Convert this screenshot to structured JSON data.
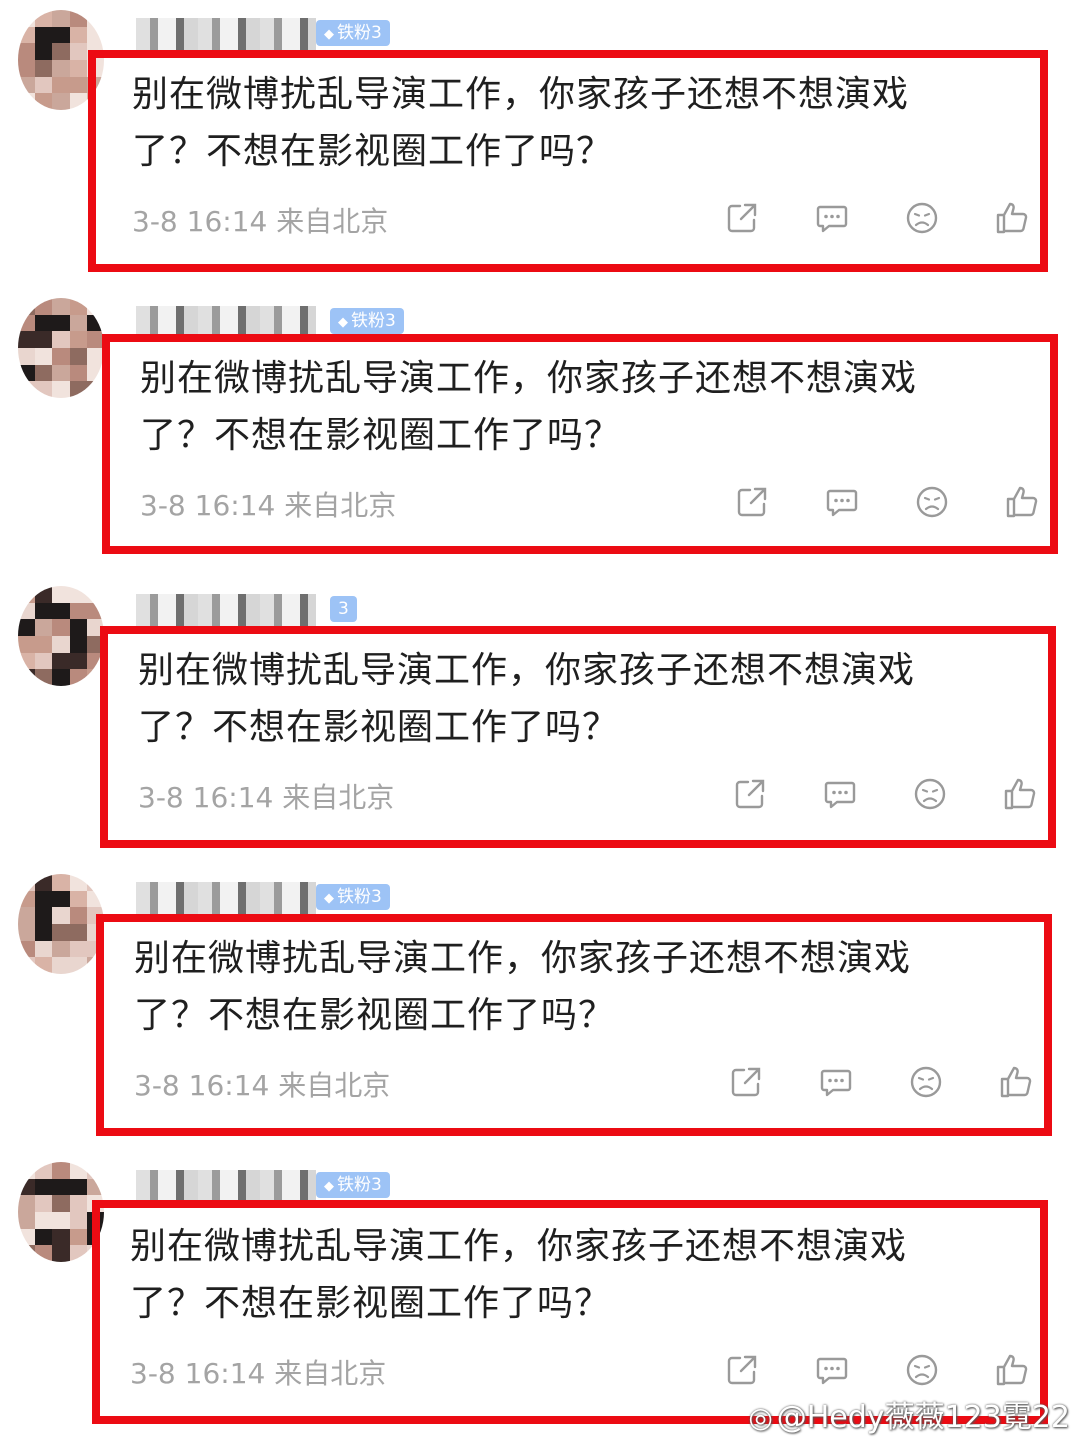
{
  "comments": [
    {
      "badge": "铁粉3",
      "text_line1": "别在微博扰乱导演工作，你家孩子还想不想演戏",
      "text_line2": "了？不想在影视圈工作了吗？",
      "meta": "3-8 16:14  来自北京"
    },
    {
      "badge": "铁粉3",
      "text_line1": "别在微博扰乱导演工作，你家孩子还想不想演戏",
      "text_line2": "了？不想在影视圈工作了吗？",
      "meta": "3-8 16:14  来自北京"
    },
    {
      "badge": "3",
      "text_line1": "别在微博扰乱导演工作，你家孩子还想不想演戏",
      "text_line2": "了？不想在影视圈工作了吗？",
      "meta": "3-8 16:14  来自北京"
    },
    {
      "badge": "铁粉3",
      "text_line1": "别在微博扰乱导演工作，你家孩子还想不想演戏",
      "text_line2": "了？不想在影视圈工作了吗？",
      "meta": "3-8 16:14  来自北京"
    },
    {
      "badge": "铁粉3",
      "text_line1": "别在微博扰乱导演工作，你家孩子还想不想演戏",
      "text_line2": "了？不想在影视圈工作了吗？",
      "meta": "3-8 16:14  来自北京"
    }
  ],
  "action_icons": [
    "share-icon",
    "comment-icon",
    "dislike-icon",
    "like-icon"
  ],
  "watermark": "@Hedy薇薇123霓22",
  "colors": {
    "highlight_frame": "#ec0b13",
    "meta_text": "#a4a4a4",
    "badge": "#9dc3f6",
    "body_text": "#1f1f1f"
  }
}
